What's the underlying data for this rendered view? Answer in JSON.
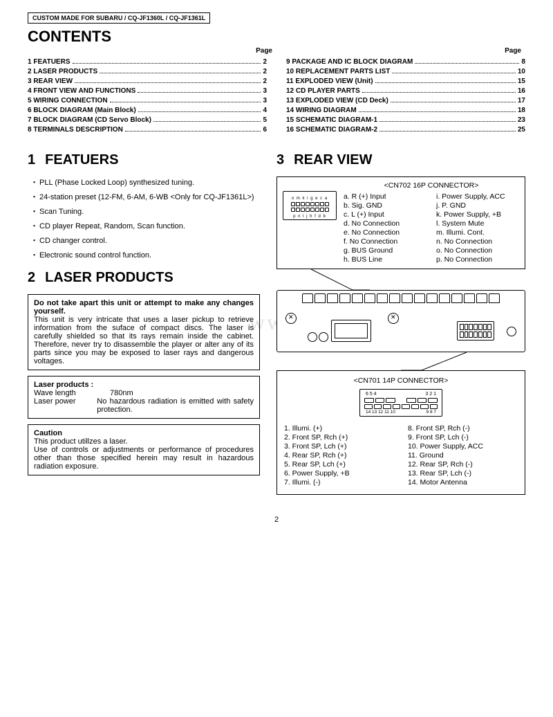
{
  "header": "CUSTOM MADE FOR SUBARU / CQ-JF1360L / CQ-JF1361L",
  "contents_title": "CONTENTS",
  "page_label": "Page",
  "toc_left": [
    {
      "label": "1 FEATUERS",
      "page": "2"
    },
    {
      "label": "2 LASER PRODUCTS",
      "page": "2"
    },
    {
      "label": "3 REAR VIEW",
      "page": "2"
    },
    {
      "label": "4 FRONT VIEW AND FUNCTIONS",
      "page": "3"
    },
    {
      "label": "5 WIRING CONNECTION",
      "page": "3"
    },
    {
      "label": "6 BLOCK DIAGRAM (Main Block)",
      "page": "4"
    },
    {
      "label": "7 BLOCK DIAGRAM (CD Servo Block)",
      "page": "5"
    },
    {
      "label": "8 TERMINALS DESCRIPTION",
      "page": "6"
    }
  ],
  "toc_right": [
    {
      "label": "9 PACKAGE AND IC BLOCK DIAGRAM",
      "page": "8"
    },
    {
      "label": "10 REPLACEMENT PARTS LIST",
      "page": "10"
    },
    {
      "label": "11 EXPLODED VIEW (Unit)",
      "page": "15"
    },
    {
      "label": "12 CD PLAYER PARTS",
      "page": "16"
    },
    {
      "label": "13 EXPLODED VIEW (CD Deck)",
      "page": "17"
    },
    {
      "label": "14 WIRING DIAGRAM",
      "page": "18"
    },
    {
      "label": "15 SCHEMATIC DIAGRAM-1",
      "page": "23"
    },
    {
      "label": "16 SCHEMATIC DIAGRAM-2",
      "page": "25"
    }
  ],
  "sec1": {
    "num": "1",
    "title": "FEATUERS"
  },
  "features": [
    "PLL (Phase Locked Loop) synthesized tuning.",
    "24-station preset (12-FM, 6-AM, 6-WB <Only for CQ-JF1361L>)",
    "Scan Tuning.",
    "CD player Repeat, Random, Scan function.",
    "CD changer control.",
    "Electronic sound control function."
  ],
  "sec2": {
    "num": "2",
    "title": "LASER PRODUCTS"
  },
  "laser_warning": {
    "bold": "Do not take apart this unit or attempt to make any changes yourself.",
    "body": "This unit is very intricate that uses a laser pickup to retrieve information from the suface of compact discs. The laser is carefully shielded so that its rays remain inside the cabinet. Therefore, never try to disassemble the player or alter any of its parts since you may be exposed to laser rays and dangerous voltages."
  },
  "laser_spec": {
    "heading": "Laser products :",
    "wave_k": "Wave length",
    "wave_v": "780nm",
    "pow_k": "Laser power",
    "pow_v": "No hazardous radiation is emitted with safety protection."
  },
  "caution": {
    "heading": "Caution",
    "body": "This product utillzes a laser.\nUse of controls or adjustments or performance of procedures other than those specified herein may result in hazardous radiation exposure."
  },
  "sec3": {
    "num": "3",
    "title": "REAR VIEW"
  },
  "cn702": {
    "title": "<CN702 16P CONNECTOR>",
    "pin_top": "o m k i g e c a",
    "pin_bot": "p n l j h f d b",
    "left": [
      "a. R (+) Input",
      "b. Sig. GND",
      "c. L (+) Input",
      "d. No Connection",
      "e. No Connection",
      "f. No Connection",
      "g. BUS Ground",
      "h. BUS Line"
    ],
    "right": [
      "i. Power Supply, ACC",
      "j. P. GND",
      "k. Power Supply, +B",
      "l. System Mute",
      "m. Illumi. Cont.",
      "n. No Connection",
      "o. No Connection",
      "p. No Connection"
    ]
  },
  "watermark": "www.radio...s.cn",
  "cn701": {
    "title": "<CN701 14P CONNECTOR>",
    "top_left": "6 5 4",
    "top_right": "3 2 1",
    "bot_left": "14 13 12  11 10",
    "bot_right": "9  8  7",
    "left": [
      "1. Illumi. (+)",
      "2. Front SP, Rch (+)",
      "3. Front SP, Lch (+)",
      "4. Rear SP, Rch (+)",
      "5. Rear SP, Lch (+)",
      "6. Power Supply, +B",
      "7. Illumi. (-)"
    ],
    "right": [
      "8. Front SP, Rch (-)",
      "9. Front SP, Lch (-)",
      "10. Power Supply, ACC",
      "11. Ground",
      "12. Rear SP, Rch (-)",
      "13. Rear SP, Lch (-)",
      "14. Motor Antenna"
    ]
  },
  "page_number": "2"
}
